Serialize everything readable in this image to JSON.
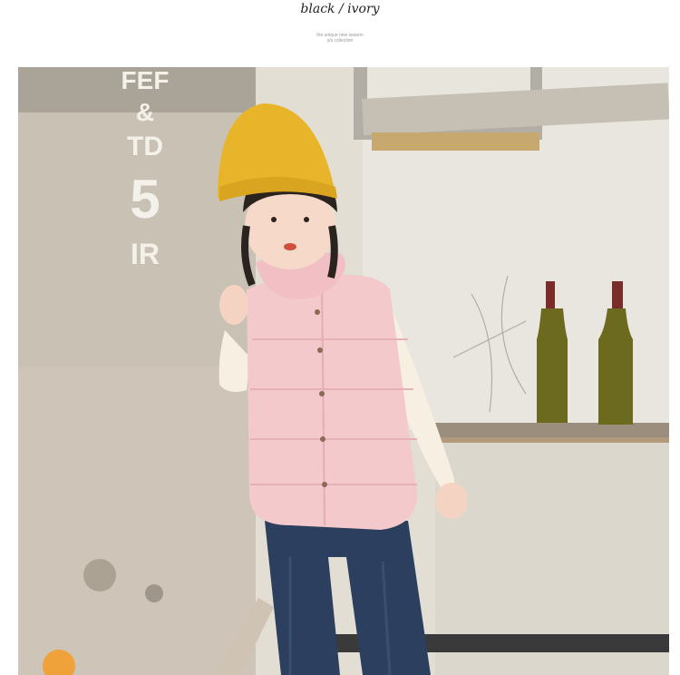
{
  "header": {
    "title": "black / ivory",
    "subtitle_line1": "the unique new season",
    "subtitle_line2": "s/s collection"
  },
  "photo": {
    "wall_letters": {
      "line1": "FEF",
      "line2": "&",
      "line3": "TD",
      "line4": "5",
      "line5": "IR"
    }
  },
  "colors": {
    "hat": "#e8b52a",
    "vest": "#f4c9cc",
    "shirt": "#f6efe2",
    "jeans": "#2c3f5e",
    "bottle": "#6b6a1e",
    "wall": "#d9d3c9"
  }
}
